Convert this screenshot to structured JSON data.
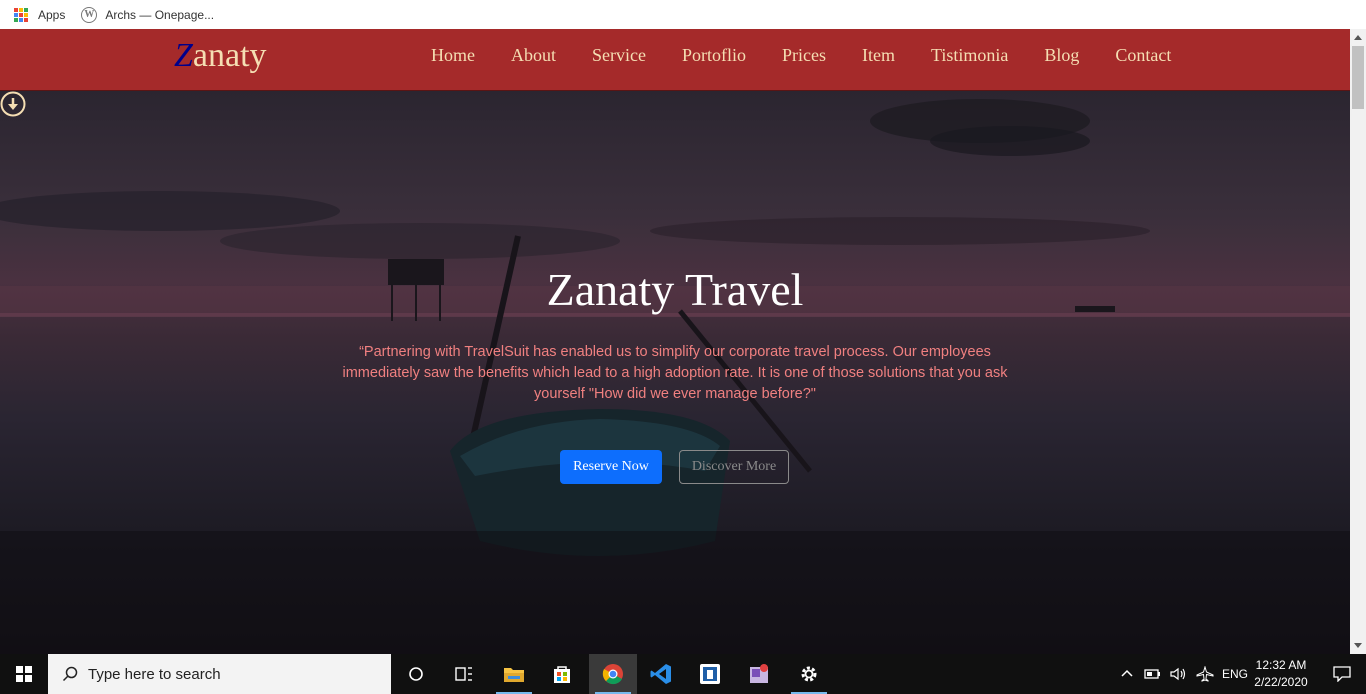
{
  "bookmarks": [
    {
      "label": "Apps",
      "icon": "apps-grid-icon"
    },
    {
      "label": "Archs — Onepage...",
      "icon": "wordpress-icon"
    }
  ],
  "navbar": {
    "logo_initial": "Z",
    "logo_rest": "anaty",
    "links": [
      "Home",
      "About",
      "Service",
      "Portoflio",
      "Prices",
      "Item",
      "Tistimonia",
      "Blog",
      "Contact"
    ],
    "bg_color": "#a52a2a",
    "text_color": "#f5deb3"
  },
  "hero": {
    "title": "Zanaty Travel",
    "quote": "“Partnering with TravelSuit has enabled us to simplify our corporate travel process. Our employees immediately saw the benefits which lead to a high adoption rate. It is one of those solutions that you ask yourself \"How did we ever manage before?\"",
    "primary_button": "Reserve Now",
    "secondary_button": "Discover More",
    "scroll_icon": "arrow-down-circle-icon"
  },
  "taskbar": {
    "search_placeholder": "Type here to search",
    "apps": [
      "task-view-icon",
      "file-explorer-icon",
      "store-icon",
      "chrome-icon",
      "vscode-icon",
      "app-icon",
      "paint-icon",
      "settings-icon"
    ],
    "language": "ENG",
    "time": "12:32 AM",
    "date": "2/22/2020"
  }
}
